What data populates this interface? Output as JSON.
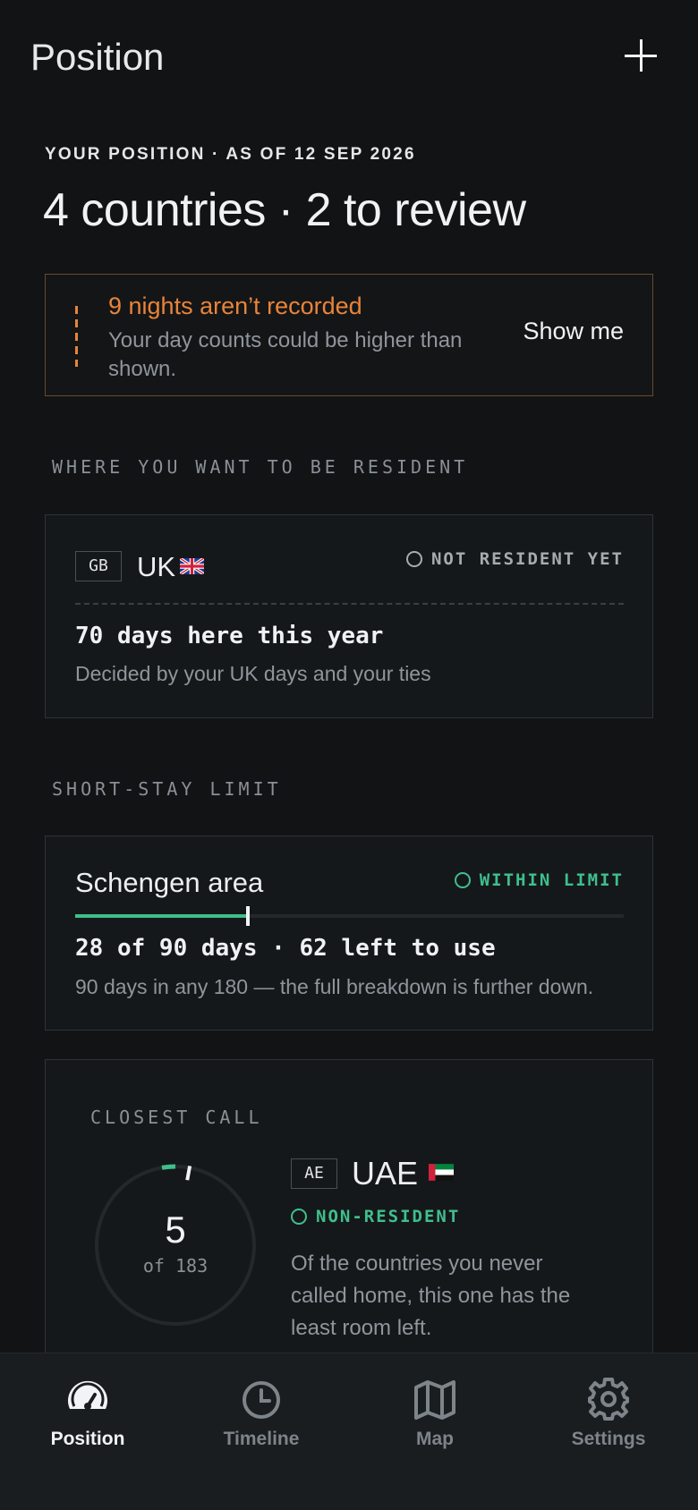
{
  "header": {
    "title": "Position",
    "add_icon": "plus-icon"
  },
  "summary": {
    "eyebrow": "YOUR POSITION · AS OF 12 SEP 2026",
    "headline": "4 countries · 2 to review"
  },
  "alert": {
    "title": "9 nights aren’t recorded",
    "body": "Your day counts could be higher than shown.",
    "action": "Show me",
    "accent_color": "#e8843a"
  },
  "resident_section": {
    "label": "WHERE YOU WANT TO BE RESIDENT",
    "card": {
      "code": "GB",
      "country": "UK",
      "flag": "gb-flag-icon",
      "status": "NOT RESIDENT YET",
      "days_text": "70 days here this year",
      "subtext": "Decided by your UK days and your ties"
    }
  },
  "short_stay_section": {
    "label": "SHORT-STAY LIMIT",
    "card": {
      "name": "Schengen area",
      "status": "WITHIN LIMIT",
      "used_days": 28,
      "limit_days": 90,
      "days_text": "28 of 90 days · 62 left to use",
      "subtext": "90 days in any 180 — the full breakdown is further down.",
      "accent_color": "#3fbf8c"
    }
  },
  "closest_call": {
    "label": "CLOSEST CALL",
    "gauge_value": "5",
    "gauge_of": "of 183",
    "gauge_max": 183,
    "code": "AE",
    "country": "UAE",
    "flag": "ae-flag-icon",
    "status": "NON-RESIDENT",
    "body": "Of the countries you never called home, this one has the least room left."
  },
  "tabbar": {
    "tabs": [
      {
        "label": "Position",
        "icon": "speedometer-icon",
        "active": true
      },
      {
        "label": "Timeline",
        "icon": "clock-icon",
        "active": false
      },
      {
        "label": "Map",
        "icon": "map-icon",
        "active": false
      },
      {
        "label": "Settings",
        "icon": "gear-icon",
        "active": false
      }
    ]
  }
}
